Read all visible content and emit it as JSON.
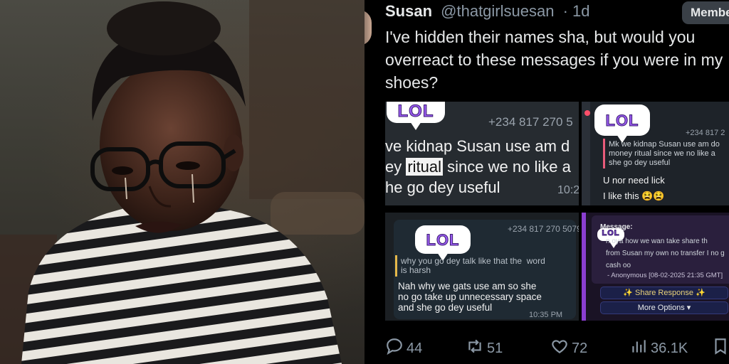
{
  "tweet": {
    "author_name": "Susan",
    "handle": "@thatgirlsuesan",
    "time": "· 1d",
    "member_label": "Member",
    "text": "I've hidden their names sha, but would you\noverreact to these messages if you were in my\nshoes?"
  },
  "screenshot1": {
    "sticker": "LOL",
    "phone": "+234 817 270 5",
    "line1": "ve kidnap Susan use am d",
    "line2_pre": "ey ",
    "line2_hl": "ritual",
    "line2_post": " since we no like a",
    "line3": "he go dey useful",
    "time": "10:2"
  },
  "screenshot2": {
    "sticker": "LOL",
    "phone": "+234 817 2",
    "quote": "Mk we kidnap Susan use am do\nmoney ritual since we no like a\nshe go dey useful",
    "reply": "U nor need lick\nI like this 😫😫"
  },
  "screenshot3": {
    "sticker": "LOL",
    "phone": "+234 817 270 5079",
    "quote": "why you go dey talk like that the  word\nis harsh",
    "reply": "Nah why we gats use am so she\nno go take up unnecessary space\nand she go dey useful",
    "time": "10:35 PM"
  },
  "screenshot4": {
    "sticker": "LOL",
    "message_label": "Message:",
    "message": "n oya how we wan take share th\nfrom Susan my own no transfer I no g\ncash oo",
    "signature": "- Anonymous [08-02-2025 21:35 GMT]",
    "share_button": "✨ Share Response ✨",
    "more_button": "More Options ▾"
  },
  "actions": {
    "replies": "44",
    "reposts": "51",
    "likes": "72",
    "views": "36.1K"
  },
  "icons": {
    "reply": "reply-icon",
    "repost": "repost-icon",
    "like": "heart-icon",
    "views": "views-icon",
    "bookmark": "bookmark-icon"
  }
}
